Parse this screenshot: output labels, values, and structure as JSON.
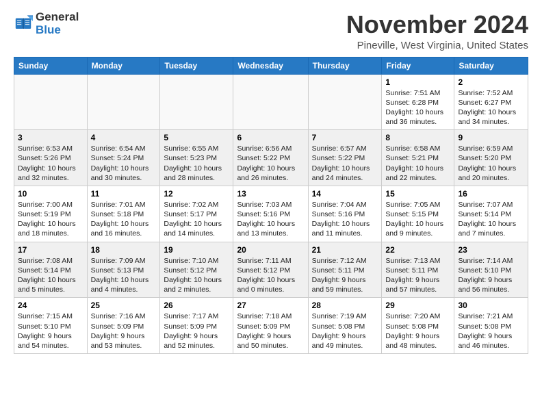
{
  "logo": {
    "line1": "General",
    "line2": "Blue"
  },
  "title": "November 2024",
  "subtitle": "Pineville, West Virginia, United States",
  "weekdays": [
    "Sunday",
    "Monday",
    "Tuesday",
    "Wednesday",
    "Thursday",
    "Friday",
    "Saturday"
  ],
  "weeks": [
    [
      {
        "day": "",
        "info": ""
      },
      {
        "day": "",
        "info": ""
      },
      {
        "day": "",
        "info": ""
      },
      {
        "day": "",
        "info": ""
      },
      {
        "day": "",
        "info": ""
      },
      {
        "day": "1",
        "info": "Sunrise: 7:51 AM\nSunset: 6:28 PM\nDaylight: 10 hours\nand 36 minutes."
      },
      {
        "day": "2",
        "info": "Sunrise: 7:52 AM\nSunset: 6:27 PM\nDaylight: 10 hours\nand 34 minutes."
      }
    ],
    [
      {
        "day": "3",
        "info": "Sunrise: 6:53 AM\nSunset: 5:26 PM\nDaylight: 10 hours\nand 32 minutes."
      },
      {
        "day": "4",
        "info": "Sunrise: 6:54 AM\nSunset: 5:24 PM\nDaylight: 10 hours\nand 30 minutes."
      },
      {
        "day": "5",
        "info": "Sunrise: 6:55 AM\nSunset: 5:23 PM\nDaylight: 10 hours\nand 28 minutes."
      },
      {
        "day": "6",
        "info": "Sunrise: 6:56 AM\nSunset: 5:22 PM\nDaylight: 10 hours\nand 26 minutes."
      },
      {
        "day": "7",
        "info": "Sunrise: 6:57 AM\nSunset: 5:22 PM\nDaylight: 10 hours\nand 24 minutes."
      },
      {
        "day": "8",
        "info": "Sunrise: 6:58 AM\nSunset: 5:21 PM\nDaylight: 10 hours\nand 22 minutes."
      },
      {
        "day": "9",
        "info": "Sunrise: 6:59 AM\nSunset: 5:20 PM\nDaylight: 10 hours\nand 20 minutes."
      }
    ],
    [
      {
        "day": "10",
        "info": "Sunrise: 7:00 AM\nSunset: 5:19 PM\nDaylight: 10 hours\nand 18 minutes."
      },
      {
        "day": "11",
        "info": "Sunrise: 7:01 AM\nSunset: 5:18 PM\nDaylight: 10 hours\nand 16 minutes."
      },
      {
        "day": "12",
        "info": "Sunrise: 7:02 AM\nSunset: 5:17 PM\nDaylight: 10 hours\nand 14 minutes."
      },
      {
        "day": "13",
        "info": "Sunrise: 7:03 AM\nSunset: 5:16 PM\nDaylight: 10 hours\nand 13 minutes."
      },
      {
        "day": "14",
        "info": "Sunrise: 7:04 AM\nSunset: 5:16 PM\nDaylight: 10 hours\nand 11 minutes."
      },
      {
        "day": "15",
        "info": "Sunrise: 7:05 AM\nSunset: 5:15 PM\nDaylight: 10 hours\nand 9 minutes."
      },
      {
        "day": "16",
        "info": "Sunrise: 7:07 AM\nSunset: 5:14 PM\nDaylight: 10 hours\nand 7 minutes."
      }
    ],
    [
      {
        "day": "17",
        "info": "Sunrise: 7:08 AM\nSunset: 5:14 PM\nDaylight: 10 hours\nand 5 minutes."
      },
      {
        "day": "18",
        "info": "Sunrise: 7:09 AM\nSunset: 5:13 PM\nDaylight: 10 hours\nand 4 minutes."
      },
      {
        "day": "19",
        "info": "Sunrise: 7:10 AM\nSunset: 5:12 PM\nDaylight: 10 hours\nand 2 minutes."
      },
      {
        "day": "20",
        "info": "Sunrise: 7:11 AM\nSunset: 5:12 PM\nDaylight: 10 hours\nand 0 minutes."
      },
      {
        "day": "21",
        "info": "Sunrise: 7:12 AM\nSunset: 5:11 PM\nDaylight: 9 hours\nand 59 minutes."
      },
      {
        "day": "22",
        "info": "Sunrise: 7:13 AM\nSunset: 5:11 PM\nDaylight: 9 hours\nand 57 minutes."
      },
      {
        "day": "23",
        "info": "Sunrise: 7:14 AM\nSunset: 5:10 PM\nDaylight: 9 hours\nand 56 minutes."
      }
    ],
    [
      {
        "day": "24",
        "info": "Sunrise: 7:15 AM\nSunset: 5:10 PM\nDaylight: 9 hours\nand 54 minutes."
      },
      {
        "day": "25",
        "info": "Sunrise: 7:16 AM\nSunset: 5:09 PM\nDaylight: 9 hours\nand 53 minutes."
      },
      {
        "day": "26",
        "info": "Sunrise: 7:17 AM\nSunset: 5:09 PM\nDaylight: 9 hours\nand 52 minutes."
      },
      {
        "day": "27",
        "info": "Sunrise: 7:18 AM\nSunset: 5:09 PM\nDaylight: 9 hours\nand 50 minutes."
      },
      {
        "day": "28",
        "info": "Sunrise: 7:19 AM\nSunset: 5:08 PM\nDaylight: 9 hours\nand 49 minutes."
      },
      {
        "day": "29",
        "info": "Sunrise: 7:20 AM\nSunset: 5:08 PM\nDaylight: 9 hours\nand 48 minutes."
      },
      {
        "day": "30",
        "info": "Sunrise: 7:21 AM\nSunset: 5:08 PM\nDaylight: 9 hours\nand 46 minutes."
      }
    ]
  ]
}
